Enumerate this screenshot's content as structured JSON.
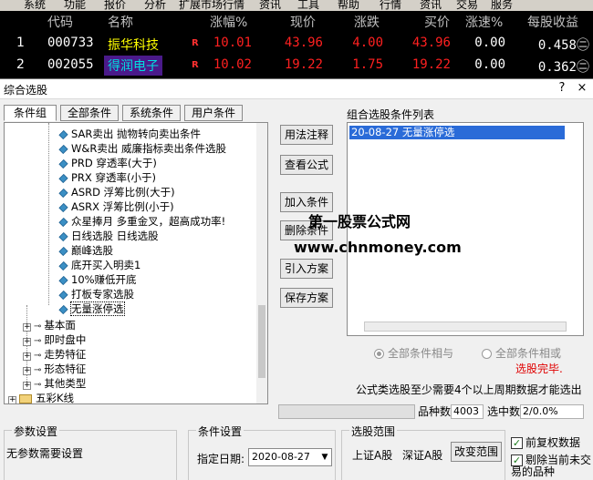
{
  "menubar": {
    "items": [
      "系统",
      "功能",
      "报价",
      "分析",
      "扩展市场行情",
      "资讯",
      "工具",
      "帮助",
      "行情",
      "资讯",
      "交易",
      "服务"
    ]
  },
  "grid": {
    "headers": [
      "代码",
      "名称",
      "涨幅%",
      "现价",
      "涨跌",
      "买价",
      "涨速%",
      "每股收益"
    ],
    "rows": [
      {
        "idx": "1",
        "code": "000733",
        "name": "振华科技",
        "badge": "R",
        "change_pct": "10.01",
        "price": "43.96",
        "change": "4.00",
        "bid": "43.96",
        "speed": "0.00",
        "eps": "0.458㊁"
      },
      {
        "idx": "2",
        "code": "002055",
        "name": "得润电子",
        "badge": "R",
        "change_pct": "10.02",
        "price": "19.22",
        "change": "1.75",
        "bid": "19.22",
        "speed": "0.00",
        "eps": "0.362㊁"
      }
    ]
  },
  "dialog": {
    "title": "综合选股",
    "help_button": "?",
    "close_button": "×",
    "tabs": [
      "条件组",
      "全部条件",
      "系统条件",
      "用户条件"
    ],
    "tree_items": [
      "SAR卖出 抛物转向卖出条件",
      "W&R卖出 威廉指标卖出条件选股",
      "PRD 穿透率(大于)",
      "PRX 穿透率(小于)",
      "ASRD 浮筹比例(大于)",
      "ASRX 浮筹比例(小于)",
      "众星捧月 多重金叉，超高成功率!",
      "日线选股 日线选股",
      "巅峰选股",
      "底开买入明卖1",
      "10%赚低开底",
      "打板专家选股",
      "无量涨停选"
    ],
    "tree_groups": [
      "基本面",
      "即时盘中",
      "走势特征",
      "形态特征",
      "其他类型",
      "五彩K线"
    ],
    "buttons": {
      "usage": "用法注释",
      "view_formula": "查看公式",
      "add": "加入条件",
      "delete": "删除条件",
      "import": "引入方案",
      "save": "保存方案",
      "change_range": "改变范围"
    },
    "list_label": "组合选股条件列表",
    "list_items": [
      "20-08-27 无量涨停选"
    ],
    "radio_and": "全部条件相与",
    "radio_or": "全部条件相或",
    "done_text": "选股完毕.",
    "note_text": "公式类选股至少需要4个以上周期数据才能选出",
    "count_label": "品种数",
    "count_value": "4003",
    "selected_label": "选中数",
    "selected_value": "2/0.0%",
    "param_group": "参数设置",
    "param_text": "无参数需要设置",
    "cond_group": "条件设置",
    "date_label": "指定日期:",
    "date_value": "2020-08-27",
    "range_group": "选股范围",
    "range_sh": "上证A股",
    "range_sz": "深证A股",
    "cb_adjust": "前复权数据",
    "cb_exclude": "剔除当前未交易的品种"
  },
  "watermark": {
    "line1": "第一股票公式网",
    "line2": "www.chnmoney.com"
  },
  "colors": {
    "red": "#ff2020",
    "yellow": "#ffff00",
    "cyan": "#00e0e0",
    "white": "#ffffff",
    "highlight": "#2a6bd8",
    "name_bg": "#4a1a8a"
  }
}
